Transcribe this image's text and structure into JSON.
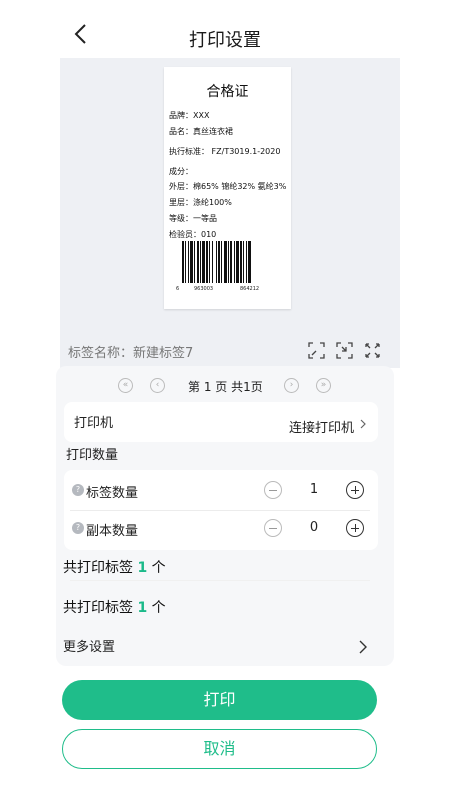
{
  "header": {
    "title": "打印设置"
  },
  "label_preview": {
    "title": "合格证",
    "rows": [
      "品牌：XXX",
      "品名：真丝连衣裙",
      "执行标准： FZ/T3019.1-2020",
      "成分：",
      "外层：棉65% 锦纶32% 氨纶3%",
      "里层：涤纶100%",
      "等级：一等品",
      "检验员：010"
    ],
    "barcode_digits": [
      "6",
      "963003",
      "864212"
    ]
  },
  "tools": {
    "label_name": "标签名称：新建标签7"
  },
  "pager": {
    "first": "«",
    "prev": "‹",
    "page_text": "第   1   页  共1页",
    "next": "›",
    "last": "»"
  },
  "printer": {
    "label": "打印机",
    "action": "连接打印机"
  },
  "quantity": {
    "title": "打印数量",
    "label_count": {
      "help": "?",
      "label": "标签数量",
      "value": "1"
    },
    "copy_count": {
      "help": "?",
      "label": "副本数量",
      "value": "0"
    }
  },
  "totals": {
    "prefix": "共打印标签",
    "count": "1",
    "suffix": "个"
  },
  "more": {
    "label": "更多设置"
  },
  "buttons": {
    "print": "打印",
    "cancel": "取消"
  }
}
